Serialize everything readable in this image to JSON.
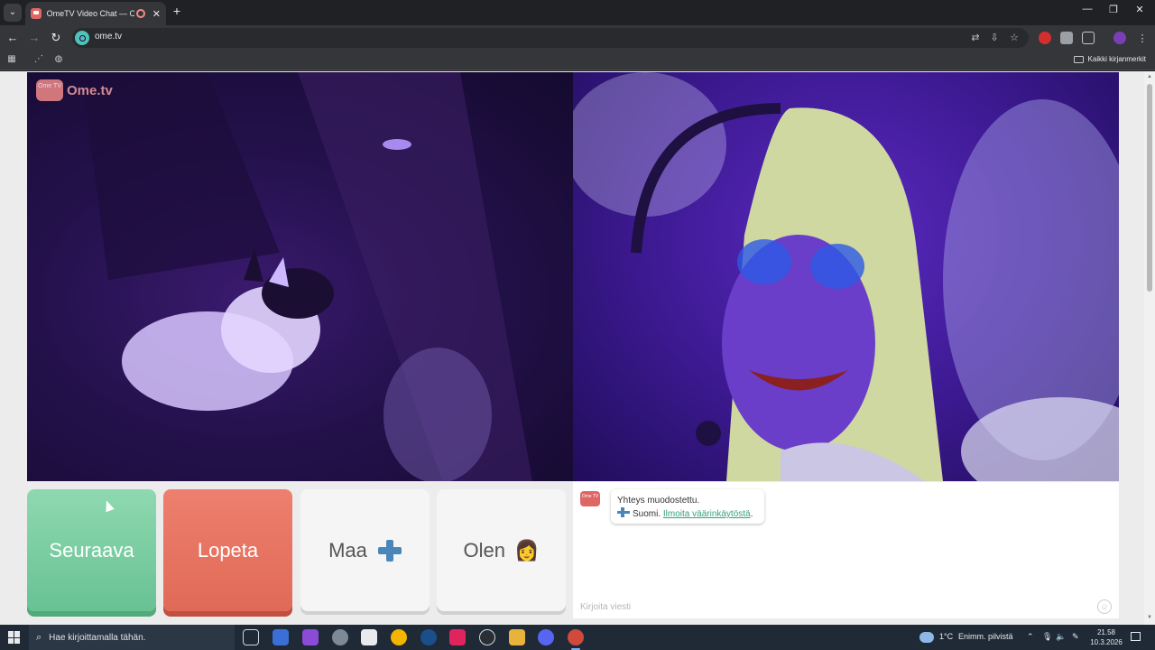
{
  "browser": {
    "tab_title": "OmeTV Video Chat — Ome",
    "tab_close": "✕",
    "new_tab": "+",
    "window_controls": [
      "—",
      "❐",
      "✕"
    ],
    "url": "ome.tv",
    "bookmarks_all_label": "Kaikki kirjanmerkit"
  },
  "page": {
    "logo_box_text": "Ome TV",
    "logo_text": "Ome.tv",
    "buttons": {
      "next_label": "Seuraava",
      "stop_label": "Lopeta",
      "country_label": "Maa",
      "gender_label": "Olen",
      "gender_emoji": "👩"
    },
    "chat": {
      "logo_text": "Ome TV",
      "connected_text": "Yhteys muodostettu.",
      "country_text": "Suomi.",
      "report_link": "Ilmoita väärinkäytöstä",
      "report_period": ".",
      "input_placeholder": "Kirjoita viesti"
    }
  },
  "taskbar": {
    "search_placeholder": "Hae kirjoittamalla tähän.",
    "weather_temp": "1°C",
    "weather_desc": "Enimm. pilvistä",
    "time": "21.58",
    "date": "10.3.2026"
  },
  "colors": {
    "next_green": "#67c294",
    "stop_red": "#e06a57",
    "link_green": "#36a17c",
    "finland_blue": "#4a86b8"
  }
}
